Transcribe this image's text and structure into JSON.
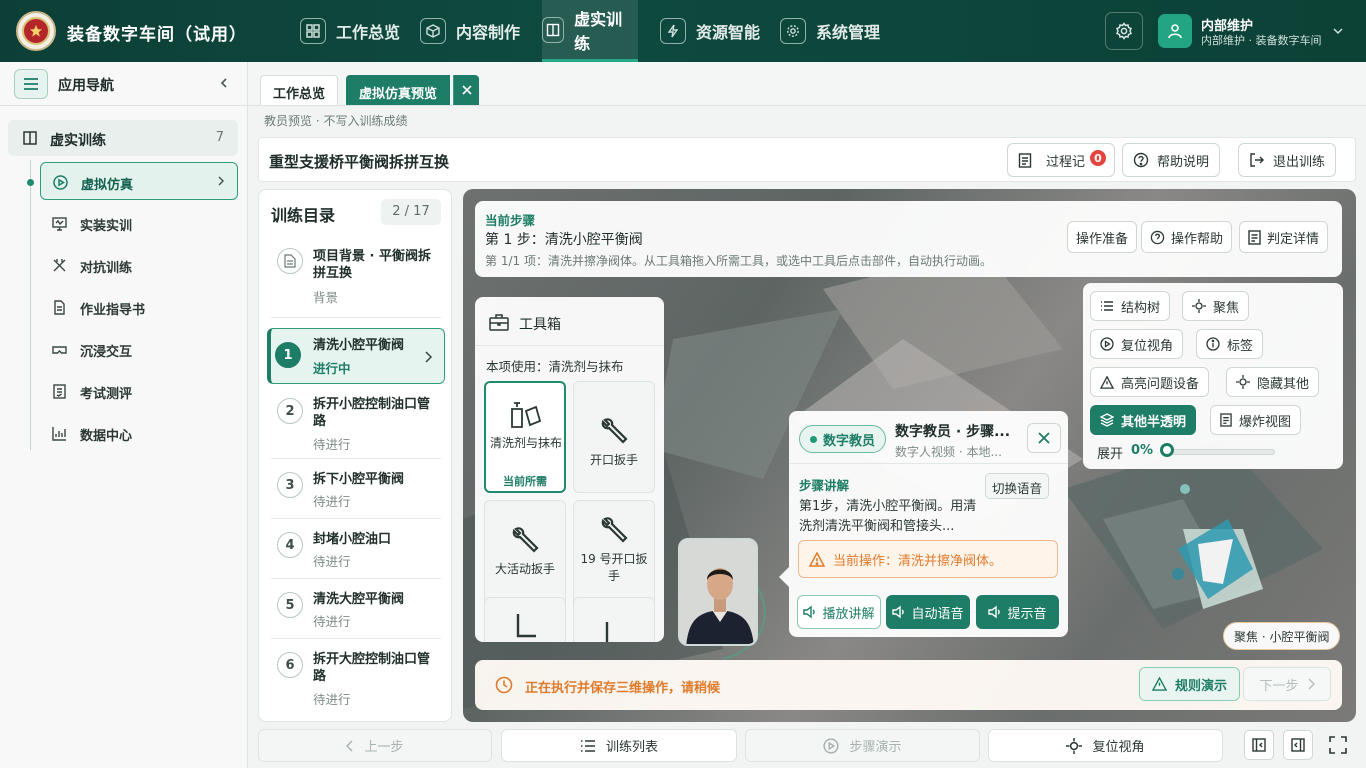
{
  "app": {
    "title": "装备数字车间（试用）"
  },
  "topnav": [
    {
      "label": "工作总览",
      "icon": "grid-icon"
    },
    {
      "label": "内容制作",
      "icon": "cube-icon"
    },
    {
      "label": "虚实训练",
      "icon": "book-icon",
      "active": true
    },
    {
      "label": "资源智能",
      "icon": "lightning-icon"
    },
    {
      "label": "系统管理",
      "icon": "gear-icon"
    }
  ],
  "user": {
    "name": "内部维护",
    "sub": "内部维护 · 装备数字车间"
  },
  "sidebar": {
    "title": "应用导航",
    "group": {
      "label": "虚实训练",
      "count": "7"
    },
    "items": [
      {
        "label": "虚拟仿真",
        "icon": "play-circle-icon",
        "active": true
      },
      {
        "label": "实装实训",
        "icon": "monitor-icon"
      },
      {
        "label": "对抗训练",
        "icon": "swords-icon"
      },
      {
        "label": "作业指导书",
        "icon": "document-icon"
      },
      {
        "label": "沉浸交互",
        "icon": "vr-icon"
      },
      {
        "label": "考试测评",
        "icon": "exam-icon"
      },
      {
        "label": "数据中心",
        "icon": "chart-icon"
      }
    ]
  },
  "tabs": [
    {
      "label": "工作总览"
    },
    {
      "label": "虚拟仿真预览",
      "active": true
    }
  ],
  "hint": "教员预览 · 不写入训练成绩",
  "training": {
    "title": "重型支援桥平衡阀拆拼互换"
  },
  "header_buttons": {
    "log": "过程记",
    "log_badge": "0",
    "help": "帮助说明",
    "exit": "退出训练"
  },
  "catalog": {
    "title": "训练目录",
    "count": "2 / 17",
    "items": [
      {
        "num": "",
        "name": "项目背景 · 平衡阀拆拼互换",
        "status": "背景"
      },
      {
        "num": "1",
        "name": "清洗小腔平衡阀",
        "status": "进行中",
        "active": true
      },
      {
        "num": "2",
        "name": "拆开小腔控制油口管路",
        "status": "待进行"
      },
      {
        "num": "3",
        "name": "拆下小腔平衡阀",
        "status": "待进行"
      },
      {
        "num": "4",
        "name": "封堵小腔油口",
        "status": "待进行"
      },
      {
        "num": "5",
        "name": "清洗大腔平衡阀",
        "status": "待进行"
      },
      {
        "num": "6",
        "name": "拆开大腔控制油口管路",
        "status": "待进行"
      }
    ]
  },
  "step": {
    "heading": "当前步骤",
    "title": "第 1 步：清洗小腔平衡阀",
    "desc": "第 1/1 项：清洗并擦净阀体。从工具箱拖入所需工具，或选中工具后点击部件，自动执行动画。",
    "buttons": [
      "操作准备",
      "操作帮助",
      "判定详情"
    ]
  },
  "toolbox": {
    "title": "工具箱",
    "use": "本项使用：清洗剂与抹布",
    "tools": [
      {
        "label": "清洗剂与抹布",
        "note": "当前所需",
        "selected": true
      },
      {
        "label": "开口扳手"
      },
      {
        "label": "大活动扳手"
      },
      {
        "label": "19 号开口扳手"
      },
      {
        "label": ""
      },
      {
        "label": ""
      }
    ]
  },
  "teacher": {
    "tag": "数字教员",
    "title": "数字教员 · 步骤...",
    "sub": "数字人视频 · 本地...",
    "heading": "步骤讲解",
    "switch": "切换语音",
    "text": "第1步，清洗小腔平衡阀。用清洗剂清洗平衡阀和管接头...",
    "warn": "当前操作：清洗并擦净阀体。",
    "buttons": [
      "播放讲解",
      "自动语音",
      "提示音"
    ]
  },
  "view": {
    "buttons": [
      "结构树",
      "聚焦",
      "复位视角",
      "标签",
      "高亮问题设备",
      "隐藏其他",
      "其他半透明",
      "爆炸视图"
    ],
    "expand_label": "展开",
    "expand_value": "0%",
    "expand_fraction": 0
  },
  "focus_tag": "聚焦 · 小腔平衡阀",
  "exec": {
    "text": "正在执行并保存三维操作，请稍候",
    "rule": "规则演示",
    "next": "下一步"
  },
  "bottom": {
    "prev": "上一步",
    "list": "训练列表",
    "demo": "步骤演示",
    "reset": "复位视角"
  },
  "colors": {
    "primary": "#1e7d66",
    "topbar": "#0e4a3f",
    "warning": "#e07b2c",
    "badge": "#e5433d"
  }
}
